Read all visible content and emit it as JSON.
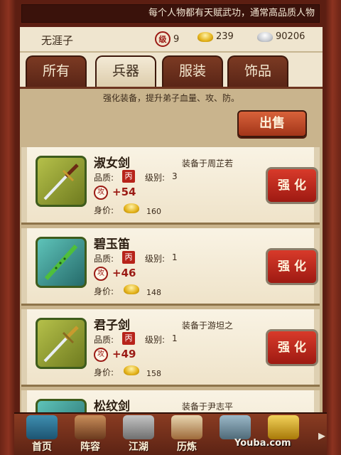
{
  "marquee_text": "每个人物都有天赋武功，通常高品质人物",
  "status": {
    "player_name": "无涯子",
    "level_icon": "级",
    "level": "9",
    "gold": "239",
    "silver": "90206"
  },
  "tabs": [
    {
      "label": "所有"
    },
    {
      "label": "兵器"
    },
    {
      "label": "服装"
    },
    {
      "label": "饰品"
    }
  ],
  "active_tab": "兵器",
  "hint": "强化装备，提升弟子血量、攻、防。",
  "sell_label": "出售",
  "labels": {
    "quality": "品质:",
    "level": "级别:",
    "price": "身价:",
    "enhance": "强 化",
    "quality_seal": "丙",
    "atk_icon": "攻"
  },
  "items": [
    {
      "name": "淑女剑",
      "level": "3",
      "atk": "+54",
      "price": "160",
      "equipped": "装备于周芷若",
      "icon": "sword-icon"
    },
    {
      "name": "碧玉笛",
      "level": "1",
      "atk": "+46",
      "price": "148",
      "equipped": "",
      "icon": "flute-icon"
    },
    {
      "name": "君子剑",
      "level": "1",
      "atk": "+49",
      "price": "158",
      "equipped": "装备于游坦之",
      "icon": "sword-icon"
    },
    {
      "name": "松纹剑",
      "level": "",
      "atk": "",
      "price": "",
      "equipped": "装备于尹志平",
      "icon": "sword-icon"
    }
  ],
  "nav": [
    {
      "label": "首页",
      "icon": "home-icon"
    },
    {
      "label": "阵容",
      "icon": "lineup-icon"
    },
    {
      "label": "江湖",
      "icon": "jianghu-icon"
    },
    {
      "label": "历炼",
      "icon": "training-icon"
    },
    {
      "label": "",
      "icon": "mountain-icon"
    },
    {
      "label": "",
      "icon": "treasure-icon"
    }
  ],
  "watermark": "Youba.com",
  "colors": {
    "accent": "#9b1b15",
    "frame": "#5c1e12",
    "paper": "#efe5cf",
    "button_red": "#c8281c"
  }
}
